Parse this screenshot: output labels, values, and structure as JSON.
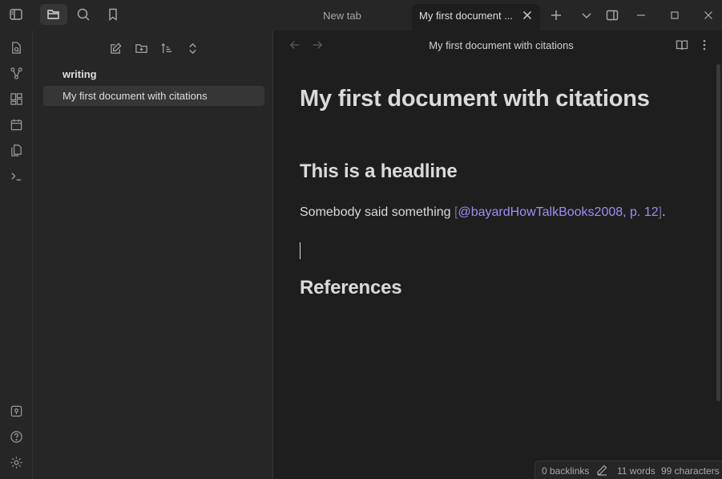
{
  "tabs": {
    "new_tab_label": "New tab",
    "active_tab_label": "My first document ..."
  },
  "sidebar": {
    "folder": "writing",
    "files": [
      "My first document with citations"
    ]
  },
  "view": {
    "title": "My first document with citations"
  },
  "document": {
    "h1": "My first document with citations",
    "h2_headline": "This is a headline",
    "para_text": "Somebody said something ",
    "cite_open": "[",
    "cite_body": "@bayardHowTalkBooks2008, p. 12",
    "cite_close": "]",
    "para_end": ".",
    "h2_references": "References"
  },
  "status": {
    "backlinks": "0 backlinks",
    "words": "11 words",
    "characters": "99 characters"
  },
  "colors": {
    "background": "#1e1e1e",
    "panel": "#262626",
    "citation": "#a28cf4"
  }
}
